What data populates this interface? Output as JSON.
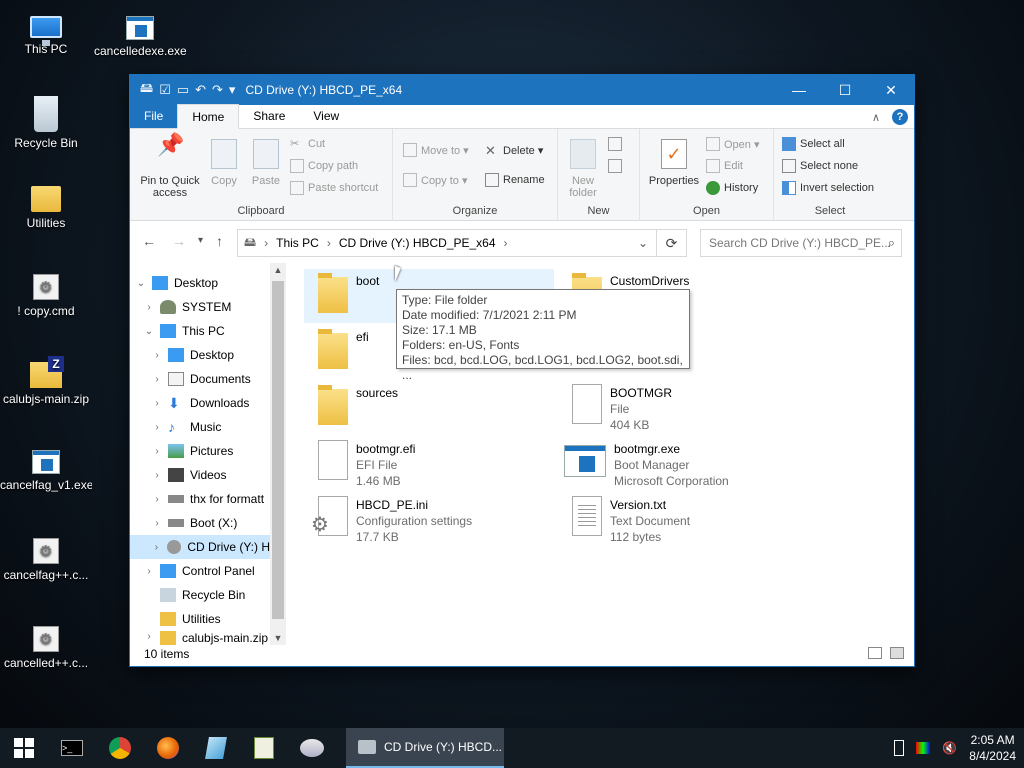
{
  "desktop": {
    "icons": [
      {
        "label": "This PC"
      },
      {
        "label": "cancelledexe.exe"
      },
      {
        "label": "Recycle Bin"
      },
      {
        "label": "Utilities"
      },
      {
        "label": "! copy.cmd"
      },
      {
        "label": "calubjs-main.zip"
      },
      {
        "label": "cancelfag_v1.exe"
      },
      {
        "label": "cancelfag++.c..."
      },
      {
        "label": "cancelled++.c..."
      }
    ]
  },
  "window": {
    "title": "CD Drive (Y:) HBCD_PE_x64",
    "controls": {
      "minimize": "—",
      "maximize": "☐",
      "close": "✕"
    }
  },
  "ribbon_tabs": {
    "file": "File",
    "home": "Home",
    "share": "Share",
    "view": "View",
    "collapse": "∧",
    "help": "?"
  },
  "ribbon": {
    "clipboard": {
      "label": "Clipboard",
      "pin": "Pin to Quick access",
      "copy": "Copy",
      "paste": "Paste",
      "cut": "Cut",
      "copy_path": "Copy path",
      "paste_shortcut": "Paste shortcut"
    },
    "organize": {
      "label": "Organize",
      "move_to": "Move to ▾",
      "copy_to": "Copy to ▾",
      "delete": "Delete ▾",
      "rename": "Rename"
    },
    "new": {
      "label": "New",
      "new_folder": "New folder"
    },
    "open": {
      "label": "Open",
      "properties": "Properties",
      "open": "Open ▾",
      "edit": "Edit",
      "history": "History"
    },
    "select": {
      "label": "Select",
      "select_all": "Select all",
      "select_none": "Select none",
      "invert": "Invert selection"
    }
  },
  "address": {
    "crumbs": [
      "This PC",
      "CD Drive (Y:) HBCD_PE_x64"
    ],
    "search_placeholder": "Search CD Drive (Y:) HBCD_PE..."
  },
  "navpane": {
    "items": [
      {
        "label": "Desktop"
      },
      {
        "label": "SYSTEM"
      },
      {
        "label": "This PC"
      },
      {
        "label": "Desktop"
      },
      {
        "label": "Documents"
      },
      {
        "label": "Downloads"
      },
      {
        "label": "Music"
      },
      {
        "label": "Pictures"
      },
      {
        "label": "Videos"
      },
      {
        "label": "thx for formatt"
      },
      {
        "label": "Boot (X:)"
      },
      {
        "label": "CD Drive (Y:) H"
      },
      {
        "label": "Control Panel"
      },
      {
        "label": "Recycle Bin"
      },
      {
        "label": "Utilities"
      },
      {
        "label": "calubjs-main.zip"
      }
    ]
  },
  "files": [
    {
      "name": "boot",
      "line2": "",
      "line3": ""
    },
    {
      "name": "CustomDrivers",
      "line2": "",
      "line3": ""
    },
    {
      "name": "efi",
      "line2": "",
      "line3": ""
    },
    {
      "name": "sources",
      "line2": "",
      "line3": ""
    },
    {
      "name": "BOOTMGR",
      "line2": "File",
      "line3": "404 KB"
    },
    {
      "name": "bootmgr.efi",
      "line2": "EFI File",
      "line3": "1.46 MB"
    },
    {
      "name": "bootmgr.exe",
      "line2": "Boot Manager",
      "line3": "Microsoft Corporation"
    },
    {
      "name": "HBCD_PE.ini",
      "line2": "Configuration settings",
      "line3": "17.7 KB"
    },
    {
      "name": "Version.txt",
      "line2": "Text Document",
      "line3": "112 bytes"
    }
  ],
  "tooltip": {
    "type": "Type: File folder",
    "modified": "Date modified: 7/1/2021 2:11 PM",
    "size": "Size: 17.1 MB",
    "folders": "Folders: en-US, Fonts",
    "files": "Files: bcd, bcd.LOG, bcd.LOG1, bcd.LOG2, boot.sdi, ..."
  },
  "status": {
    "items": "10 items"
  },
  "taskbar": {
    "active_task": "CD Drive (Y:) HBCD...",
    "time": "2:05 AM",
    "date": "8/4/2024"
  }
}
